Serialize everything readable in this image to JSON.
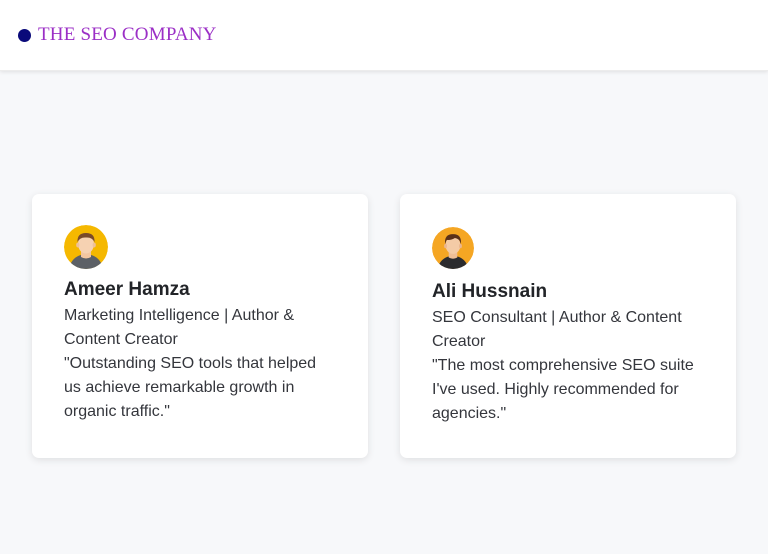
{
  "header": {
    "brand": "THE SEO COMPANY",
    "brand_color": "#9b2fc6",
    "dot_color": "#0a0a7a",
    "dot_icon": "circle-dot-icon"
  },
  "testimonials": [
    {
      "name": "Ameer Hamza",
      "role": "Marketing Intelligence | Author & Content Creator",
      "quote": "\"Outstanding SEO tools that helped us achieve remarkable growth in organic traffic.\"",
      "avatar_icon": "male-avatar-icon",
      "avatar_bg": "#f5b800"
    },
    {
      "name": "Ali Hussnain",
      "role": "SEO Consultant | Author & Content Creator",
      "quote": "\"The most comprehensive SEO suite I've used. Highly recommended for agencies.\"",
      "avatar_icon": "male-avatar-icon",
      "avatar_bg": "#f5a623"
    }
  ]
}
